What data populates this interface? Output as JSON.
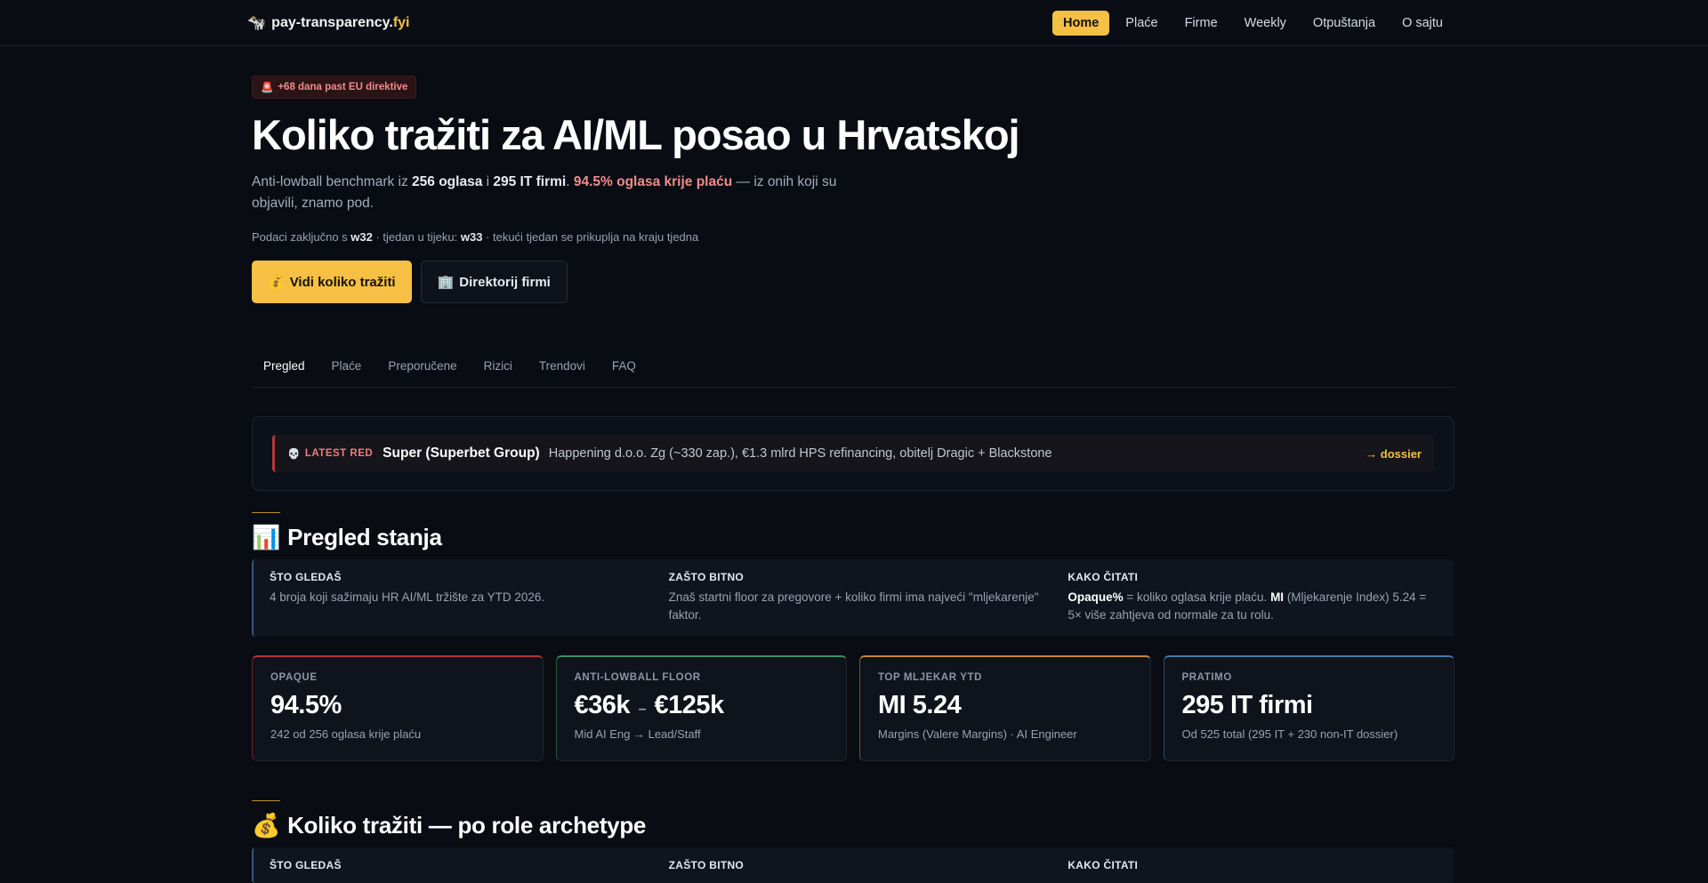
{
  "nav": {
    "logo_icon": "🐄",
    "logo_name": "pay-transparency.",
    "logo_tld": "fyi",
    "items": [
      {
        "label": "Home",
        "active": true
      },
      {
        "label": "Plaće"
      },
      {
        "label": "Firme"
      },
      {
        "label": "Weekly"
      },
      {
        "label": "Otpuštanja"
      },
      {
        "label": "O sajtu"
      }
    ]
  },
  "hero": {
    "badge_icon": "🚨",
    "badge": "+68 dana past EU direktive",
    "title": "Koliko tražiti za AI/ML posao u Hrvatskoj",
    "sub_pre": "Anti-lowball benchmark iz ",
    "sub_ads": "256 oglasa",
    "sub_and": " i ",
    "sub_firms": "295 IT firmi",
    "sub_dot": ". ",
    "sub_hl": "94.5% oglasa krije plaću",
    "sub_post": " — iz onih koji su objavili, znamo pod.",
    "meta_pre": "Podaci zaključno s ",
    "meta_w1": "w32",
    "meta_mid": " · tjedan u tijeku: ",
    "meta_w2": "w33",
    "meta_post": " · tekući tjedan se prikuplja na kraju tjedna",
    "cta_primary_icon": "💰",
    "cta_primary": "Vidi koliko tražiti",
    "cta_secondary_icon": "🏢",
    "cta_secondary": "Direktorij firmi"
  },
  "tabs": [
    {
      "label": "Pregled",
      "active": true
    },
    {
      "label": "Plaće"
    },
    {
      "label": "Preporučene"
    },
    {
      "label": "Rizici"
    },
    {
      "label": "Trendovi"
    },
    {
      "label": "FAQ"
    }
  ],
  "latest": {
    "icon": "💀",
    "tag": "LATEST RED",
    "name": "Super (Superbet Group)",
    "desc": "Happening d.o.o. Zg (~330 zap.), €1.3 mlrd HPS refinancing, obitelj Dragic + Blackstone",
    "link": "→ dossier"
  },
  "overview": {
    "icon": "📊",
    "title": "Pregled stanja",
    "what_head": "ŠTO GLEDAŠ",
    "what_body": "4 broja koji sažimaju HR AI/ML tržište za YTD 2026.",
    "why_head": "ZAŠTO BITNO",
    "why_body": "Znaš startni floor za pregovore + koliko firmi ima najveći \"mljekarenje\" faktor.",
    "how_head": "KAKO ČITATI",
    "how_b1": "Opaque%",
    "how_t1": " = koliko oglasa krije plaću. ",
    "how_b2": "MI",
    "how_t2": " (Mljekarenje Index) 5.24 = 5× više zahtjeva od normale za tu rolu."
  },
  "kpis": [
    {
      "label": "OPAQUE",
      "value": "94.5%",
      "sub": "242 od 256 oglasa krije plaću",
      "color": "#b3373a"
    },
    {
      "label": "ANTI-LOWBALL FLOOR",
      "value_a": "€36k",
      "value_sep": "–",
      "value_b": "€125k",
      "sub": "Mid AI Eng → Lead/Staff",
      "color": "#3c8f63"
    },
    {
      "label": "TOP MLJEKAR YTD",
      "value": "MI 5.24",
      "sub": "Margins (Valere Margins) · AI Engineer",
      "color": "#c4883a"
    },
    {
      "label": "PRATIMO",
      "value": "295 IT firmi",
      "sub": "Od 525 total (295 IT + 230 non-IT dossier)",
      "color": "#4a77a8"
    }
  ],
  "section2": {
    "icon": "💰",
    "title": "Koliko tražiti — po role archetype",
    "what_head": "ŠTO GLEDAŠ",
    "why_head": "ZAŠTO BITNO",
    "how_head": "KAKO ČITATI"
  }
}
